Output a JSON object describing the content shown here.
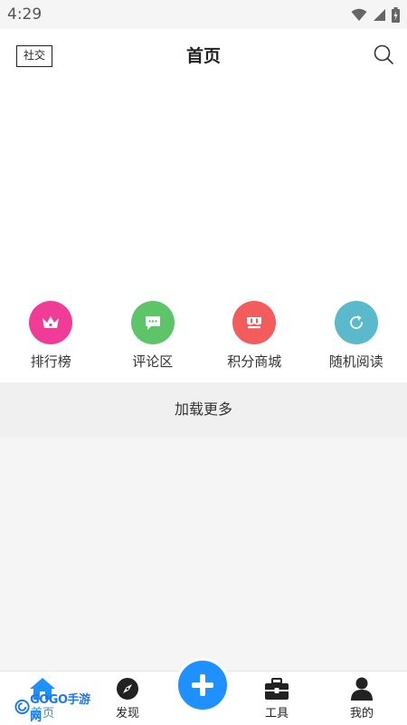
{
  "status_bar": {
    "time": "4:29"
  },
  "header": {
    "social_label": "社交",
    "title": "首页"
  },
  "quick_nav": [
    {
      "label": "排行榜",
      "color": "#f03c96",
      "icon": "crown-icon"
    },
    {
      "label": "评论区",
      "color": "#5ec46a",
      "icon": "chat-bubble-icon"
    },
    {
      "label": "积分商城",
      "color": "#f25c5c",
      "icon": "store-icon"
    },
    {
      "label": "随机阅读",
      "color": "#5bb9cc",
      "icon": "refresh-icon"
    }
  ],
  "load_more": "加载更多",
  "tab_bar": {
    "home": "首页",
    "discover": "发现",
    "tools": "工具",
    "mine": "我的",
    "accent": "#1e90ff"
  },
  "watermark": {
    "logo": "GOGO手游网"
  }
}
